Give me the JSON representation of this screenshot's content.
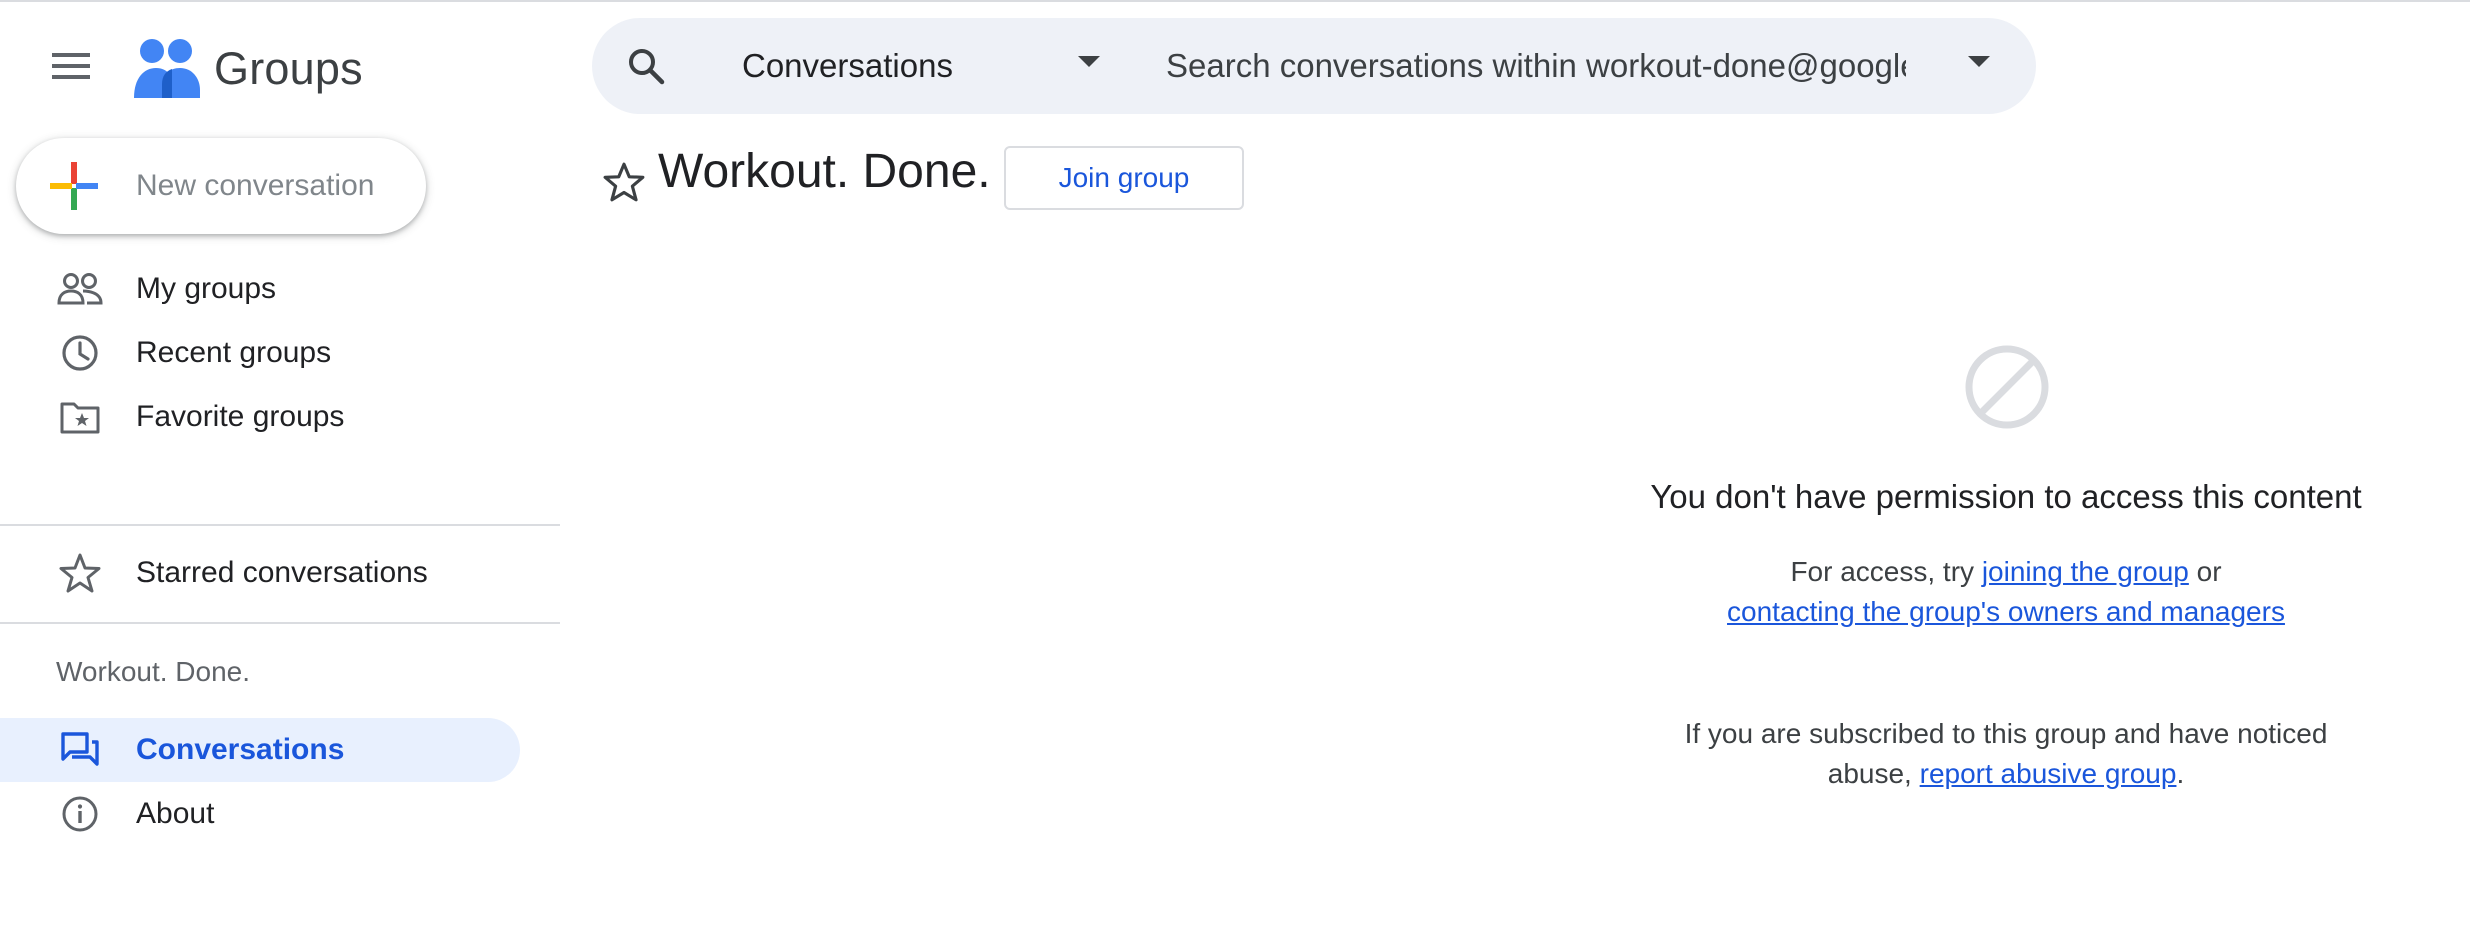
{
  "header": {
    "app_name": "Groups",
    "menu_icon": "hamburger-menu-icon",
    "logo_icon": "groups-people-icon",
    "logo_color": "#4285f4"
  },
  "search": {
    "icon": "search-icon",
    "scope_selected": "Conversations",
    "placeholder": "Search conversations within workout-done@google...",
    "options_icon": "caret-down-icon"
  },
  "sidebar": {
    "new_conversation_label": "New conversation",
    "items": [
      {
        "label": "My groups",
        "icon": "people-icon"
      },
      {
        "label": "Recent groups",
        "icon": "clock-icon"
      },
      {
        "label": "Favorite groups",
        "icon": "folder-star-icon"
      }
    ],
    "starred_label": "Starred conversations",
    "section_title": "Workout. Done.",
    "group_items": [
      {
        "label": "Conversations",
        "icon": "forum-icon",
        "active": true
      },
      {
        "label": "About",
        "icon": "info-icon",
        "active": false
      }
    ]
  },
  "main": {
    "group_title": "Workout. Done.",
    "join_label": "Join group",
    "message_icon": "block-icon",
    "permission_title": "You don't have permission to access this content",
    "access_prefix": "For access, try ",
    "join_link": "joining the group",
    "access_middle": " or",
    "contact_link": "contacting the group's owners and managers",
    "abuse_text": "If you are subscribed to this group and have noticed abuse, ",
    "abuse_link": "report abusive group",
    "abuse_suffix": "."
  },
  "colors": {
    "accent": "#1a56db",
    "active_bg": "#e8f0fe",
    "search_bg": "#eef1f7"
  }
}
